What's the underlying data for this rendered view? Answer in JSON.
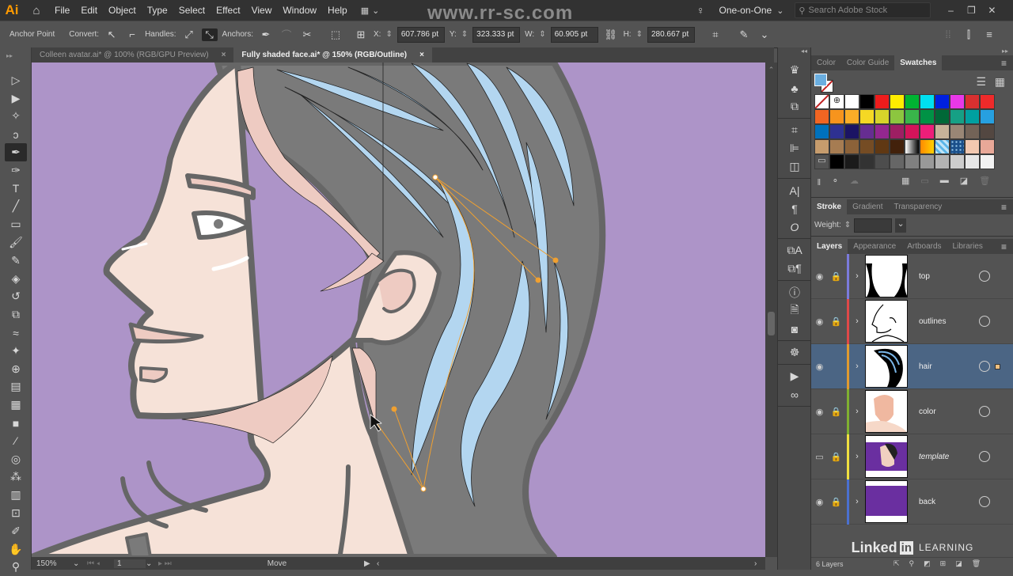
{
  "app": {
    "logo": "Ai",
    "menu": [
      "File",
      "Edit",
      "Object",
      "Type",
      "Select",
      "Effect",
      "View",
      "Window",
      "Help"
    ],
    "watermark": "www.rr-sc.com",
    "workspace": "One-on-One",
    "search_placeholder": "Search Adobe Stock"
  },
  "control": {
    "tool_name": "Anchor Point",
    "convert_label": "Convert:",
    "handles_label": "Handles:",
    "anchors_label": "Anchors:",
    "x_label": "X:",
    "x": "607.786 pt",
    "y_label": "Y:",
    "y": "323.333 pt",
    "w_label": "W:",
    "w": "60.905 pt",
    "h_label": "H:",
    "h": "280.667 pt"
  },
  "doc_tabs": [
    {
      "label": "Colleen avatar.ai* @ 100% (RGB/GPU Preview)",
      "active": false
    },
    {
      "label": "Fully shaded face.ai* @ 150% (RGB/Outline)",
      "active": true
    }
  ],
  "status": {
    "zoom": "150%",
    "artboard": "1",
    "tool": "Move"
  },
  "panels": {
    "color_tabs": [
      "Color",
      "Color Guide",
      "Swatches"
    ],
    "swatches": [
      "none",
      "registration",
      "#ffffff",
      "#000000",
      "#ee1c1c",
      "#ffec00",
      "#00b432",
      "#00e0f0",
      "#0020e0",
      "#e838e8",
      "#d83030",
      "#ee2a2a",
      "#f26522",
      "#f7941d",
      "#fbad27",
      "#f5d824",
      "#d7d42a",
      "#8cc63f",
      "#39b54a",
      "#009245",
      "#006837",
      "#16a085",
      "#00a0a0",
      "#27a0e0",
      "#0071bc",
      "#2e3192",
      "#1b1464",
      "#662d91",
      "#93278f",
      "#9e1f63",
      "#d4145a",
      "#ed1e79",
      "#c7b299",
      "#998675",
      "#736357",
      "#534741",
      "#c69c6d",
      "#a67c52",
      "#8c6239",
      "#754c24",
      "#603813",
      "#42210b",
      "gradient-bw",
      "gradient-orange",
      "pattern-blue",
      "pattern-dots",
      "#f2c8b0",
      "#e8a898",
      "folder",
      "#000000",
      "#1a1a1a",
      "#333333",
      "#4d4d4d",
      "#666666",
      "#808080",
      "#999999",
      "#b3b3b3",
      "#cccccc",
      "#e6e6e6",
      "#f2f2f2"
    ],
    "stroke_tabs": [
      "Stroke",
      "Gradient",
      "Transparency"
    ],
    "weight_label": "Weight:",
    "layer_tabs": [
      "Layers",
      "Appearance",
      "Artboards",
      "Libraries"
    ],
    "layers": [
      {
        "name": "top",
        "color": "#7b7bdc",
        "locked": true,
        "visible": true,
        "selected": false
      },
      {
        "name": "outlines",
        "color": "#e04848",
        "locked": true,
        "visible": true,
        "selected": false
      },
      {
        "name": "hair",
        "color": "#e09a30",
        "locked": false,
        "visible": true,
        "selected": true
      },
      {
        "name": "color",
        "color": "#80b030",
        "locked": true,
        "visible": true,
        "selected": false
      },
      {
        "name": "template",
        "color": "#f0e040",
        "locked": true,
        "visible": "template",
        "selected": false
      },
      {
        "name": "back",
        "color": "#4a70d0",
        "locked": true,
        "visible": true,
        "selected": false
      }
    ],
    "layer_count": "6 Layers",
    "brand": "Linked",
    "brand_in": "in",
    "brand_learning": "LEARNING"
  },
  "colors": {
    "canvas": "#ad94c8",
    "skin": "#f6e2d8",
    "blush": "#eecbc2",
    "hair": "#7a7a7a",
    "hair_highlight": "#b3d6f0",
    "outline": "#666666",
    "path": "#f0a030"
  }
}
